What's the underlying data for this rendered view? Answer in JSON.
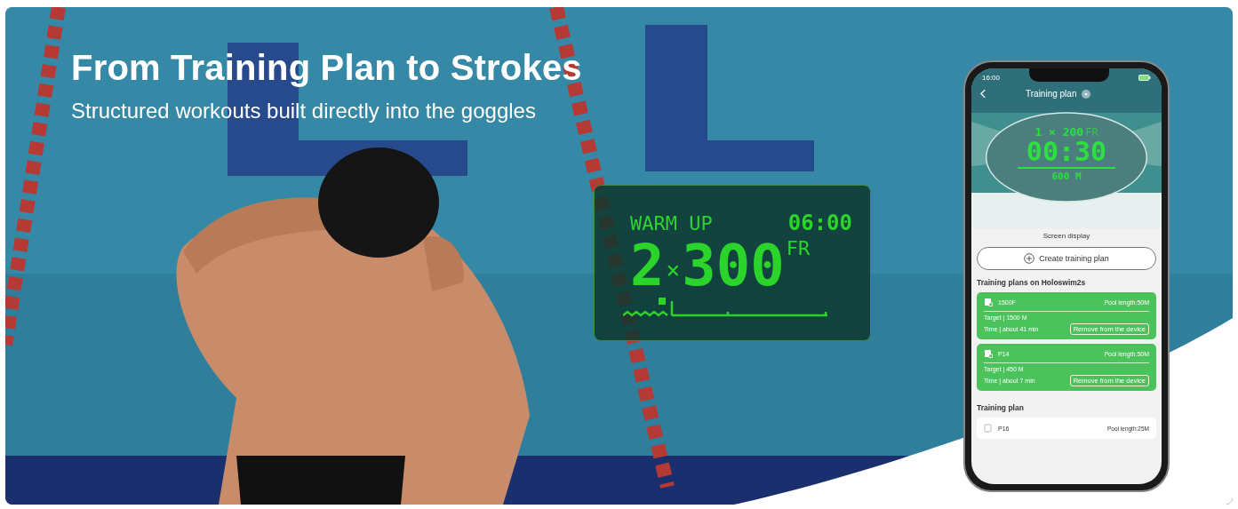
{
  "hero": {
    "title": "From Training Plan to Strokes",
    "subtitle": "Structured workouts built directly into the goggles"
  },
  "goggle_display": {
    "label": "WARM UP",
    "time": "06:00",
    "set_count": "2",
    "set_sign": "×",
    "set_distance": "300",
    "stroke": "FR"
  },
  "phone": {
    "status_time": "16:00",
    "title": "Training plan",
    "preview": {
      "set": "1 × 200",
      "stroke": "FR",
      "time": "00:30",
      "distance": "600 M"
    },
    "preview_caption": "Screen display",
    "create_button": "Create training plan",
    "device_section": "Training plans on Holoswim2s",
    "device_plans": [
      {
        "name": "1500F",
        "pool_length": "Pool length:50M",
        "target": "Target | 1500 M",
        "time": "Time | about 41 min",
        "action": "Remove from the device"
      },
      {
        "name": "P14",
        "pool_length": "Pool length:50M",
        "target": "Target | 450 M",
        "time": "Time | about 7 min",
        "action": "Remove from the device"
      }
    ],
    "library_section": "Training plan",
    "library_plans": [
      {
        "name": "P16",
        "pool_length": "Pool length:25M"
      }
    ]
  }
}
